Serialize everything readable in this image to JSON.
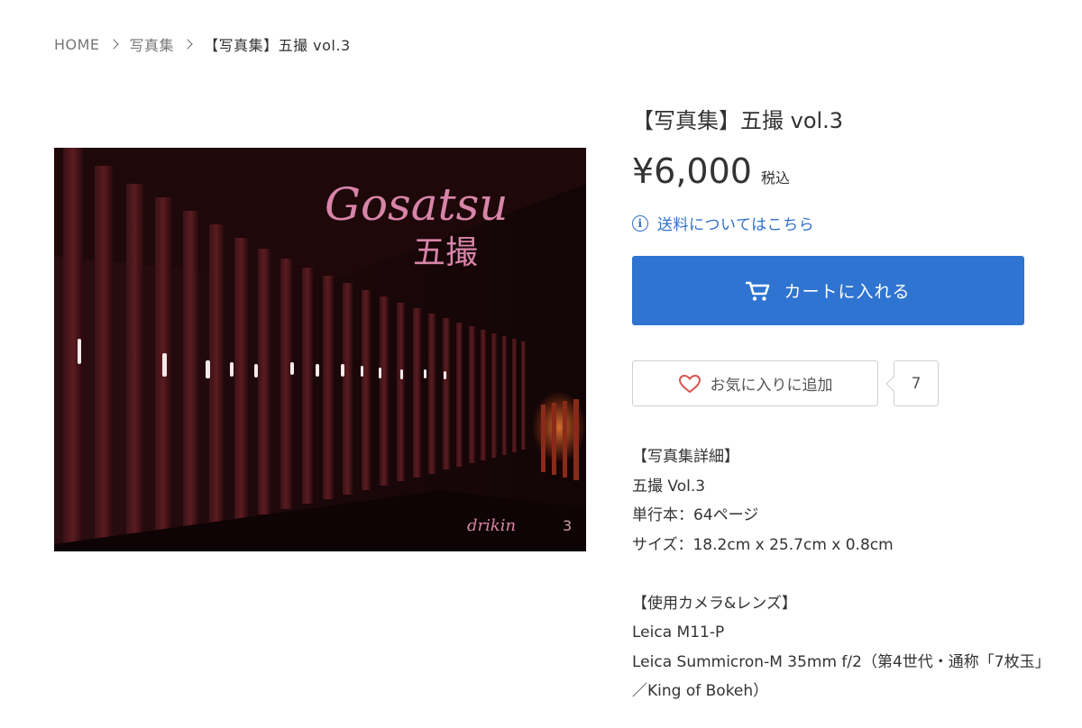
{
  "breadcrumb": {
    "items": [
      "HOME",
      "写真集",
      "【写真集】五撮 vol.3"
    ]
  },
  "product": {
    "title": "【写真集】五撮 vol.3",
    "price": "¥6,000",
    "tax_label": "税込",
    "shipping_link": "送料についてはこちら",
    "cart_button": "カートに入れる",
    "favorite_button": "お気に入りに追加",
    "favorite_count": "7",
    "image": {
      "title_text": "Gosatsu",
      "kanji_text": "五撮",
      "author_text": "drikin",
      "volume_text": "3"
    },
    "description": {
      "details_heading": "【写真集詳細】",
      "details": [
        "五撮 Vol.3",
        "単行本：64ページ",
        "サイズ：18.2cm x 25.7cm x 0.8cm"
      ],
      "gear_heading": "【使用カメラ&レンズ】",
      "gear": [
        "Leica M11-P",
        "Leica Summicron-M 35mm f/2（第4世代・通称「7枚玉」",
        "／King of Bokeh）"
      ]
    }
  },
  "colors": {
    "accent": "#2f74d0",
    "link": "#2f6fca",
    "heart": "#d9534f",
    "cover_title": "#d884a8"
  },
  "icons": {
    "breadcrumb_separator": "chevron-right-icon",
    "info": "info-icon",
    "cart": "cart-icon",
    "favorite": "heart-icon"
  }
}
